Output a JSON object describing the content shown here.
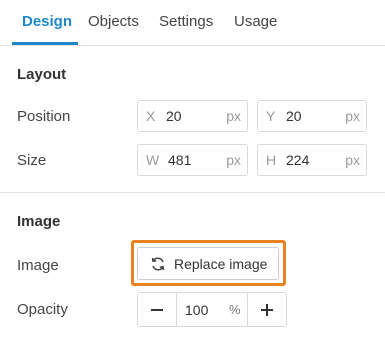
{
  "tabs": [
    {
      "label": "Design",
      "active": true
    },
    {
      "label": "Objects",
      "active": false
    },
    {
      "label": "Settings",
      "active": false
    },
    {
      "label": "Usage",
      "active": false
    }
  ],
  "layout": {
    "title": "Layout",
    "position": {
      "label": "Position",
      "x": {
        "prefix": "X",
        "value": "20",
        "unit": "px"
      },
      "y": {
        "prefix": "Y",
        "value": "20",
        "unit": "px"
      }
    },
    "size": {
      "label": "Size",
      "w": {
        "prefix": "W",
        "value": "481",
        "unit": "px"
      },
      "h": {
        "prefix": "H",
        "value": "224",
        "unit": "px"
      }
    }
  },
  "image": {
    "title": "Image",
    "image_label": "Image",
    "replace_button": {
      "label": "Replace image",
      "icon": "refresh-icon"
    },
    "opacity": {
      "label": "Opacity",
      "value": "100",
      "unit": "%"
    }
  },
  "colors": {
    "accent": "#1e88c8",
    "highlight": "#e8821e"
  }
}
